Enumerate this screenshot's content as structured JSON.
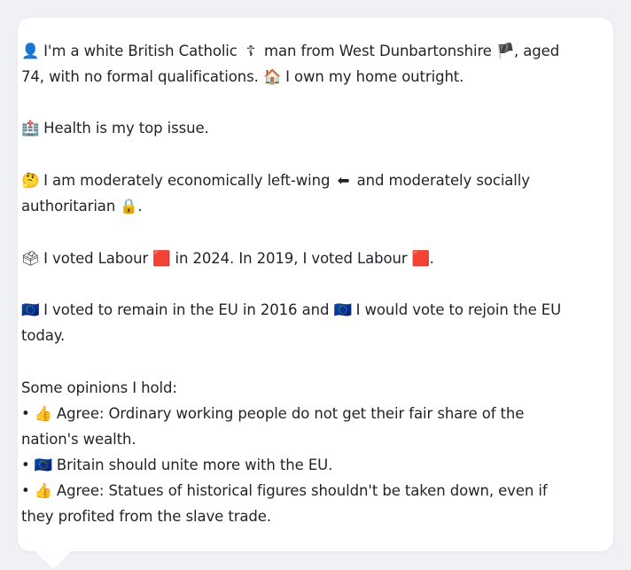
{
  "profile": {
    "intro": {
      "icon": "👤",
      "text_a": " I'm a white British Catholic ",
      "icon2": "☦",
      "text_b": " man from West Dunbartonshire ",
      "icon3": "🏴",
      "text_c": ", aged 74, with no formal qualifications. ",
      "icon4": "🏠",
      "text_d": " I own my home outright."
    },
    "issue": {
      "icon": "🏥",
      "text": " Health is my top issue."
    },
    "ideology": {
      "icon": "🤔",
      "text_a": " I am moderately economically left-wing ",
      "icon2": "⬅",
      "text_b": " and moderately socially authoritarian ",
      "icon3": "🔒",
      "text_c": "."
    },
    "votes": {
      "icon": "🗳",
      "text_a": " I voted Labour ",
      "icon2": "🟥",
      "text_b": " in 2024. In 2019, I voted Labour ",
      "icon3": "🟥",
      "text_c": "."
    },
    "eu": {
      "icon": "🇪🇺",
      "text_a": " I voted to remain in the EU in 2016 and ",
      "icon2": "🇪🇺",
      "text_b": " I would vote to rejoin the EU today."
    },
    "opinions_heading": "Some opinions I hold:",
    "opinions": [
      {
        "bullet": "• ",
        "icon": "👍",
        "text": " Agree: Ordinary working people do not get their fair share of the nation's wealth."
      },
      {
        "bullet": "• ",
        "icon": "🇪🇺",
        "text": " Britain should unite more with the EU."
      },
      {
        "bullet": "• ",
        "icon": "👍",
        "text": " Agree: Statues of historical figures shouldn't be taken down, even if they profited from the slave trade."
      }
    ]
  },
  "colors": {
    "background": "#f0f1f5",
    "card": "#ffffff",
    "text": "#1f2328"
  }
}
